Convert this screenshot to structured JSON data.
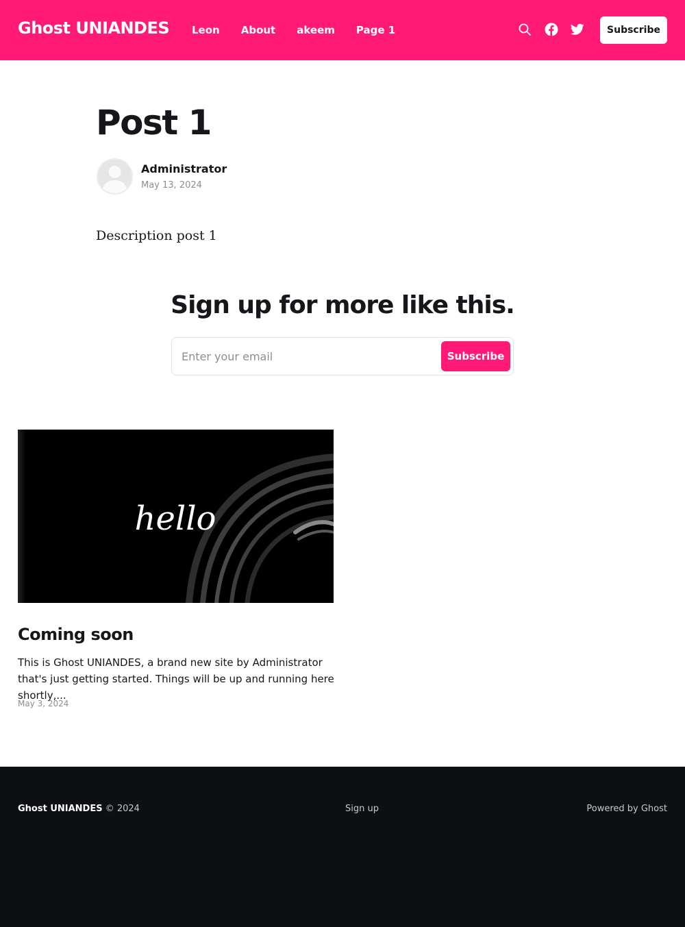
{
  "header": {
    "site_title": "Ghost UNIANDES",
    "nav": [
      "Leon",
      "About",
      "akeem",
      "Page 1"
    ],
    "subscribe_label": "Subscribe",
    "icons": [
      "search-icon",
      "facebook-icon",
      "twitter-icon"
    ]
  },
  "post": {
    "title": "Post 1",
    "author": "Administrator",
    "date": "May 13, 2024",
    "body": "Description post 1"
  },
  "cta": {
    "title": "Sign up for more like this.",
    "email_placeholder": "Enter your email",
    "button_label": "Subscribe"
  },
  "related": {
    "image_text": "hello",
    "title": "Coming soon",
    "excerpt": "This is Ghost UNIANDES, a brand new site by Administrator that's just getting started. Things will be up and running here shortly,...",
    "date": "May 3, 2024"
  },
  "footer": {
    "site_title": "Ghost UNIANDES",
    "copyright": " © 2024",
    "signup": "Sign up",
    "powered": "Powered by Ghost"
  },
  "colors": {
    "accent": "#ff1a75",
    "footer_bg": "#0d0f12"
  }
}
